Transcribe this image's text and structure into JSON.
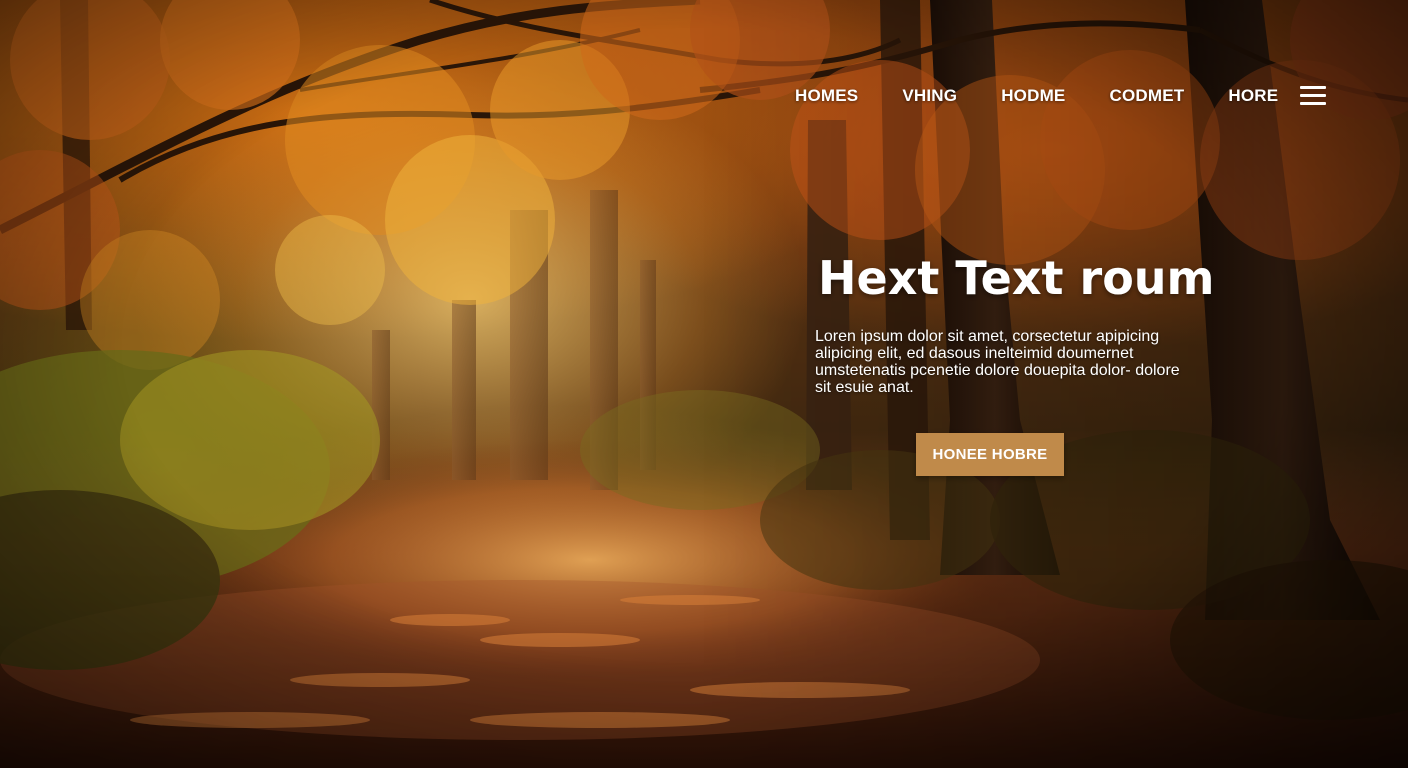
{
  "nav": {
    "items": [
      {
        "label": "HOMES"
      },
      {
        "label": "VHING"
      },
      {
        "label": "HODME"
      },
      {
        "label": "CODMET"
      },
      {
        "label": "HORE"
      }
    ],
    "menu_icon": "hamburger-menu-icon"
  },
  "hero": {
    "title": "Hext Text roum",
    "body": "Loren ipsum dolor sit amet, corsectetur apipicing alipicing elit, ed dasous inelteimid doumernet umstetenatis pcenetie dolore douepita dolor- dolore sit esuie anat.",
    "button_label": "HONEE HOBRE"
  },
  "colors": {
    "button_background": "#c08a4a",
    "text": "#ffffff",
    "foliage_orange": "#d9741c",
    "foliage_gold": "#f0b43c"
  }
}
